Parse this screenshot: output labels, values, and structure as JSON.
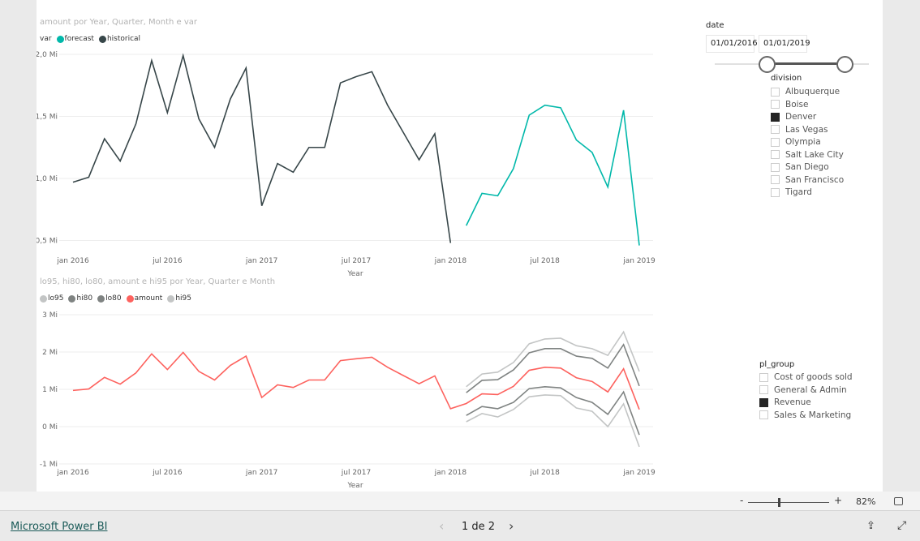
{
  "chart1": {
    "title": "amount por Year, Quarter, Month e var",
    "legend_title": "var",
    "legend": [
      {
        "name": "forecast",
        "color": "#01b8aa"
      },
      {
        "name": "historical",
        "color": "#374649"
      }
    ],
    "yticks": [
      "2,0 Mi",
      "1,5 Mi",
      "1,0 Mi",
      "0,5 Mi"
    ],
    "xticks": [
      "jan 2016",
      "jul 2016",
      "jan 2017",
      "jul 2017",
      "jan 2018",
      "jul 2018",
      "jan 2019"
    ],
    "xlabel": "Year"
  },
  "chart2": {
    "title": "lo95, hi80, lo80, amount e hi95 por Year, Quarter e Month",
    "legend": [
      {
        "name": "lo95",
        "color": "#c3c5c5"
      },
      {
        "name": "hi80",
        "color": "#7f8382"
      },
      {
        "name": "lo80",
        "color": "#7f8382"
      },
      {
        "name": "amount",
        "color": "#fd625e"
      },
      {
        "name": "hi95",
        "color": "#c3c5c5"
      }
    ],
    "yticks": [
      "3 Mi",
      "2 Mi",
      "1 Mi",
      "0 Mi",
      "-1 Mi"
    ],
    "xticks": [
      "jan 2016",
      "jul 2016",
      "jan 2017",
      "jul 2017",
      "jan 2018",
      "jul 2018",
      "jan 2019"
    ],
    "xlabel": "Year"
  },
  "chart_data": [
    {
      "type": "line",
      "title": "amount por Year, Quarter, Month e var",
      "xlabel": "Year",
      "ylabel": "",
      "ylim": [
        0.45,
        2.05
      ],
      "x_start": "2016-01",
      "x_end": "2019-01",
      "unit": "Mi",
      "series": [
        {
          "name": "historical",
          "x_start": "2016-01",
          "values": [
            0.97,
            1.01,
            1.32,
            1.14,
            1.44,
            1.95,
            1.53,
            1.99,
            1.48,
            1.25,
            1.64,
            1.89,
            0.78,
            1.12,
            1.05,
            1.25,
            1.25,
            1.77,
            1.82,
            1.86,
            1.59,
            1.37,
            1.15,
            1.36,
            0.48
          ]
        },
        {
          "name": "forecast",
          "x_start": "2018-02",
          "values": [
            0.62,
            0.88,
            0.86,
            1.08,
            1.51,
            1.59,
            1.57,
            1.31,
            1.21,
            0.93,
            1.55,
            0.46
          ]
        }
      ]
    },
    {
      "type": "line",
      "title": "lo95, hi80, lo80, amount e hi95 por Year, Quarter e Month",
      "xlabel": "Year",
      "ylim": [
        -1,
        3
      ],
      "unit": "Mi",
      "series": [
        {
          "name": "amount",
          "x_start": "2016-01",
          "values": [
            0.97,
            1.01,
            1.32,
            1.14,
            1.44,
            1.95,
            1.53,
            1.99,
            1.48,
            1.25,
            1.64,
            1.89,
            0.78,
            1.12,
            1.05,
            1.25,
            1.25,
            1.77,
            1.82,
            1.86,
            1.59,
            1.37,
            1.15,
            1.36,
            0.48,
            0.62,
            0.88,
            0.86,
            1.08,
            1.51,
            1.59,
            1.57,
            1.31,
            1.21,
            0.93,
            1.55,
            0.46
          ]
        },
        {
          "name": "hi95",
          "x_start": "2018-02",
          "values": [
            1.07,
            1.41,
            1.46,
            1.72,
            2.22,
            2.35,
            2.37,
            2.17,
            2.09,
            1.91,
            2.54,
            1.48
          ]
        },
        {
          "name": "hi80",
          "x_start": "2018-02",
          "values": [
            0.91,
            1.24,
            1.26,
            1.52,
            1.98,
            2.09,
            2.09,
            1.89,
            1.83,
            1.57,
            2.2,
            1.09
          ]
        },
        {
          "name": "lo80",
          "x_start": "2018-02",
          "values": [
            0.3,
            0.54,
            0.48,
            0.65,
            1.02,
            1.07,
            1.04,
            0.78,
            0.65,
            0.33,
            0.93,
            -0.22
          ]
        },
        {
          "name": "lo95",
          "x_start": "2018-02",
          "values": [
            0.13,
            0.35,
            0.26,
            0.46,
            0.8,
            0.85,
            0.83,
            0.5,
            0.41,
            0.0,
            0.61,
            -0.54
          ]
        }
      ]
    }
  ],
  "date_slicer": {
    "title": "date",
    "start": "01/01/2016",
    "end": "01/01/2019"
  },
  "division_slicer": {
    "title": "division",
    "items": [
      {
        "label": "Albuquerque",
        "checked": false
      },
      {
        "label": "Boise",
        "checked": false
      },
      {
        "label": "Denver",
        "checked": true
      },
      {
        "label": "Las Vegas",
        "checked": false
      },
      {
        "label": "Olympia",
        "checked": false
      },
      {
        "label": "Salt Lake City",
        "checked": false
      },
      {
        "label": "San Diego",
        "checked": false
      },
      {
        "label": "San Francisco",
        "checked": false
      },
      {
        "label": "Tigard",
        "checked": false
      }
    ]
  },
  "pl_group_slicer": {
    "title": "pl_group",
    "items": [
      {
        "label": "Cost of goods sold",
        "checked": false
      },
      {
        "label": "General & Admin",
        "checked": false
      },
      {
        "label": "Revenue",
        "checked": true
      },
      {
        "label": "Sales & Marketing",
        "checked": false
      }
    ]
  },
  "zoom": {
    "minus": "-",
    "plus": "+",
    "level": "82%"
  },
  "footer": {
    "brand": "Microsoft Power BI",
    "page": "1 de 2",
    "prev": "‹",
    "next": "›"
  }
}
